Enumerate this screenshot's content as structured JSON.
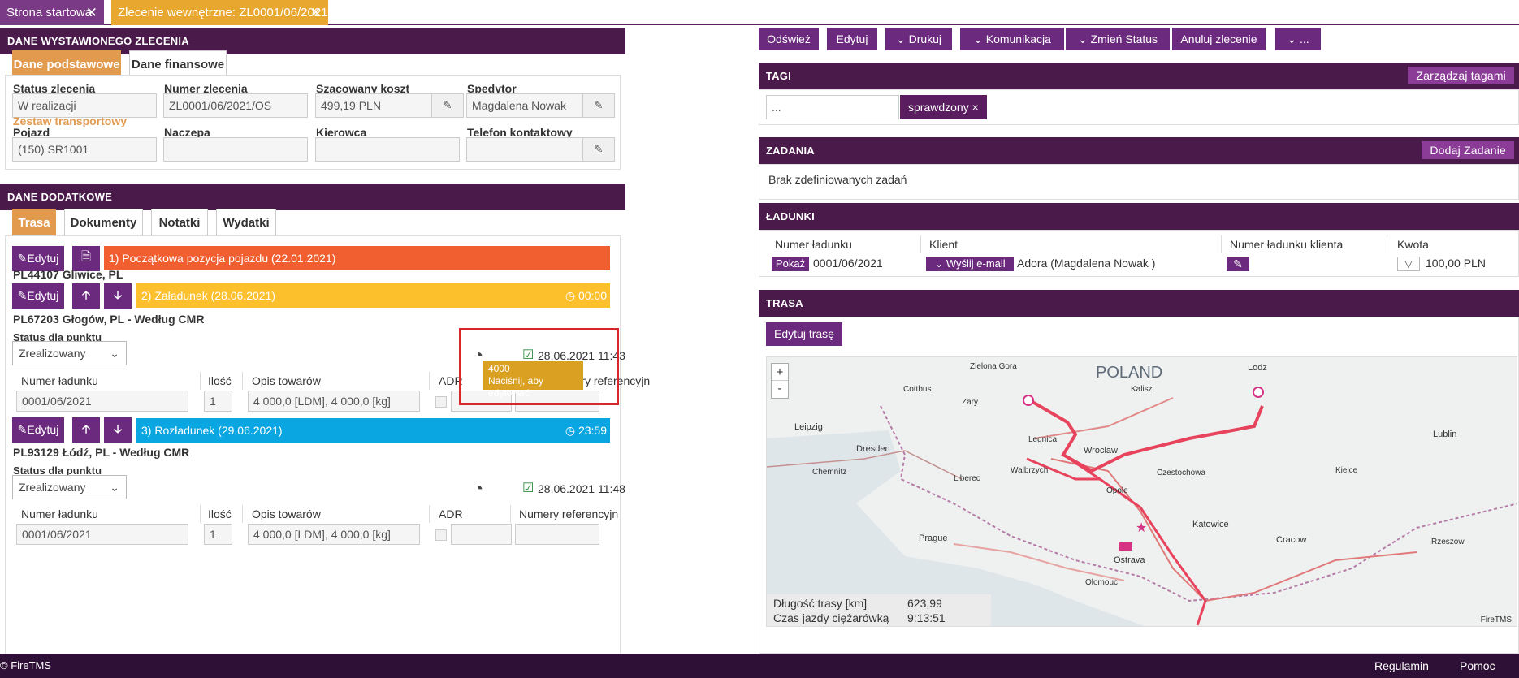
{
  "tabs": [
    {
      "label": "Strona startowa"
    },
    {
      "label": "Zlecenie wewnętrzne: ZL0001/06/2021..."
    }
  ],
  "issued": {
    "title": "DANE WYSTAWIONEGO ZLECENIA",
    "tabs": [
      "Dane podstawowe",
      "Dane finansowe"
    ],
    "status_label": "Status zlecenia",
    "status_value": "W realizacji",
    "number_label": "Numer zlecenia",
    "number_value": "ZL0001/06/2021/OS",
    "cost_label": "Szacowany koszt",
    "cost_value": "499,19 PLN",
    "forwarder_label": "Spedytor",
    "forwarder_value": "Magdalena Nowak",
    "set_label": "Zestaw transportowy",
    "vehicle_label": "Pojazd",
    "vehicle_value": "(150) SR1001",
    "trailer_label": "Naczepa",
    "driver_label": "Kierowca",
    "phone_label": "Telefon kontaktowy"
  },
  "extra": {
    "title": "DANE DODATKOWE",
    "tabs": [
      "Trasa",
      "Dokumenty",
      "Notatki",
      "Wydatki"
    ]
  },
  "route": {
    "edit_label": "Edytuj",
    "stop1": {
      "title": "1) Początkowa pozycja pojazdu (22.01.2021)",
      "place": "PL44107 Gliwice, PL"
    },
    "stop2": {
      "title": "2) Załadunek (28.06.2021)",
      "time": "00:00",
      "place": "PL67203 Głogów, PL - Według CMR",
      "status_label": "Status dla punktu",
      "status_value": "Zrealizowany",
      "date": "28.06.2021 11:43",
      "headers": [
        "Numer ładunku",
        "Ilość",
        "Opis towarów",
        "ADR",
        "Numery referencyjn"
      ],
      "row": [
        "0001/06/2021",
        "1",
        "4 000,0 [LDM], 4 000,0 [kg]"
      ]
    },
    "stop3": {
      "title": "3) Rozładunek (29.06.2021)",
      "time": "23:59",
      "place": "PL93129 Łódź, PL - Według CMR",
      "status_label": "Status dla punktu",
      "status_value": "Zrealizowany",
      "date": "28.06.2021 11:48",
      "headers": [
        "Numer ładunku",
        "Ilość",
        "Opis towarów",
        "ADR",
        "Numery referencyjn"
      ],
      "row": [
        "0001/06/2021",
        "1",
        "4 000,0 [LDM], 4 000,0 [kg]"
      ]
    },
    "tooltip": {
      "value": "4000",
      "hint": "Naciśnij, aby edytować"
    }
  },
  "toolbar": {
    "refresh": "Odśwież",
    "edit": "Edytuj",
    "print": "Drukuj",
    "communication": "Komunikacja",
    "change_status": "Zmień Status",
    "cancel": "Anuluj zlecenie",
    "more": "..."
  },
  "tags": {
    "title": "TAGI",
    "manage": "Zarządzaj tagami",
    "input_placeholder": "...",
    "tag": "sprawdzony ×"
  },
  "tasks": {
    "title": "ZADANIA",
    "add": "Dodaj Zadanie",
    "empty": "Brak zdefiniowanych zadań"
  },
  "loads": {
    "title": "ŁADUNKI",
    "headers": [
      "Numer ładunku",
      "Klient",
      "Numer ładunku klienta",
      "Kwota"
    ],
    "show": "Pokaż",
    "load_no": "0001/06/2021",
    "send_email": "Wyślij e-mail",
    "client": "Adora (Magdalena Nowak )",
    "amount": "100,00 PLN"
  },
  "trasa": {
    "title": "TRASA",
    "edit_route": "Edytuj trasę",
    "length_label": "Długość trasy [km]",
    "length_value": "623,99",
    "time_label": "Czas jazdy ciężarówką",
    "time_value": "9:13:51",
    "attribution": "FireTMS",
    "map_labels": [
      "POLAND",
      "Lodz",
      "Wroclaw",
      "Katowice",
      "Ostrava",
      "Cracow",
      "Prague",
      "Dresden",
      "Leipzig",
      "Opole",
      "Legnica",
      "Kalisz",
      "Czestochowa",
      "Kielce",
      "Lublin",
      "Liberec",
      "Chemnitz",
      "Cottbus",
      "Zielona Gora",
      "Rzeszow",
      "Olomouc",
      "Walbrzych",
      "Zary"
    ],
    "zoom_in": "+",
    "zoom_out": "-"
  },
  "footer": {
    "brand": "FireTMS",
    "terms": "Regulamin",
    "help": "Pomoc"
  },
  "colors": {
    "primary": "#4a1a4a",
    "button": "#6b2a7e",
    "stop1": "#f15f30",
    "stop2": "#fcc02d",
    "stop3": "#0aa6e1",
    "tab_active": "#e29a4f"
  }
}
